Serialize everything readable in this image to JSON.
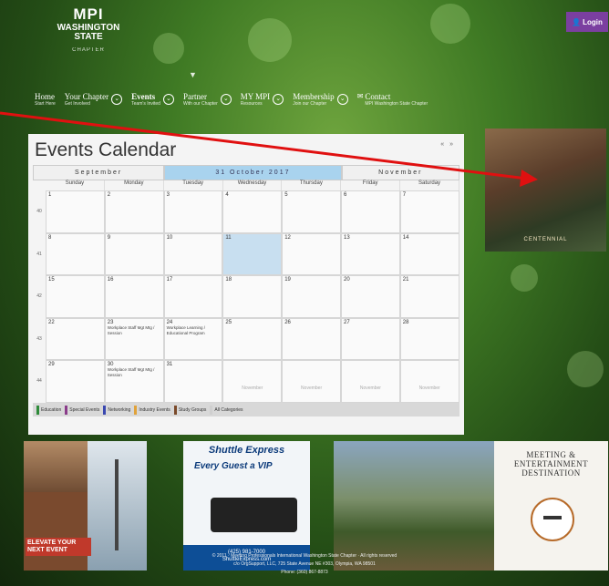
{
  "header": {
    "logo_mpi": "MPI",
    "logo_state": "WASHINGTON STATE",
    "logo_chapter": "CHAPTER",
    "login_label": "Login",
    "caret": "▼"
  },
  "nav": [
    {
      "title": "Home",
      "sub": "Start Here"
    },
    {
      "title": "Your Chapter",
      "sub": "Get Involved"
    },
    {
      "title": "Events",
      "sub": "Team's Invited"
    },
    {
      "title": "Partner",
      "sub": "With our Chapter"
    },
    {
      "title": "MY MPI",
      "sub": "Resources"
    },
    {
      "title": "Membership",
      "sub": "Join our Chapter"
    },
    {
      "title": "Contact",
      "sub": "MPI Washington State Chapter"
    }
  ],
  "calendar": {
    "title": "Events Calendar",
    "controls": "« »",
    "prev_month": "September",
    "current_month": "31 October 2017",
    "next_month": "November",
    "weekdays": [
      "Sunday",
      "Monday",
      "Tuesday",
      "Wednesday",
      "Thursday",
      "Friday",
      "Saturday"
    ],
    "week_numbers": [
      "40",
      "41",
      "42",
      "43",
      "44"
    ],
    "rows": [
      [
        "1",
        "2",
        "3",
        "4",
        "5",
        "6",
        "7"
      ],
      [
        "8",
        "9",
        "10",
        "11",
        "12",
        "13",
        "14"
      ],
      [
        "15",
        "16",
        "17",
        "18",
        "19",
        "20",
        "21"
      ],
      [
        "22",
        "23",
        "24",
        "25",
        "26",
        "27",
        "28"
      ],
      [
        "29",
        "30",
        "31",
        "November",
        "November",
        "November",
        "November"
      ]
    ],
    "events": {
      "23": "Workplace Staff Mgt Mtg / Session",
      "24": "Workplace Learning / Educational Program",
      "30": "Workplace Staff Mgt Mtg / Session"
    },
    "legend": [
      {
        "label": "Education",
        "color": "#2e8b3a"
      },
      {
        "label": "Special Events",
        "color": "#8a3c8a"
      },
      {
        "label": "Networking",
        "color": "#3a48b0"
      },
      {
        "label": "Industry Events",
        "color": "#e0a23a"
      },
      {
        "label": "Study Groups",
        "color": "#7a4a2a"
      },
      {
        "label": "All Categories",
        "color": "#cfcfcf"
      }
    ]
  },
  "side_photo_caption": "CENTENNIAL",
  "banners": {
    "b1_text": "ELEVATE YOUR NEXT EVENT",
    "b2_brand": "Shuttle Express",
    "b2_slogan": "Every Guest a VIP",
    "b2_phone": "(425) 981-7000",
    "b2_site": "ShuttleExpress.com",
    "b4_title": "MEETING & ENTERTAINMENT DESTINATION"
  },
  "footer": {
    "line1": "© 2011 · Meeting Professionals International Washington State Chapter · All rights reserved",
    "line2": "c/o OrgSupport, LLC, 725 State Avenue NE #303, Olympia, WA 98501",
    "line3": "Phone: (360) 867-8873"
  }
}
